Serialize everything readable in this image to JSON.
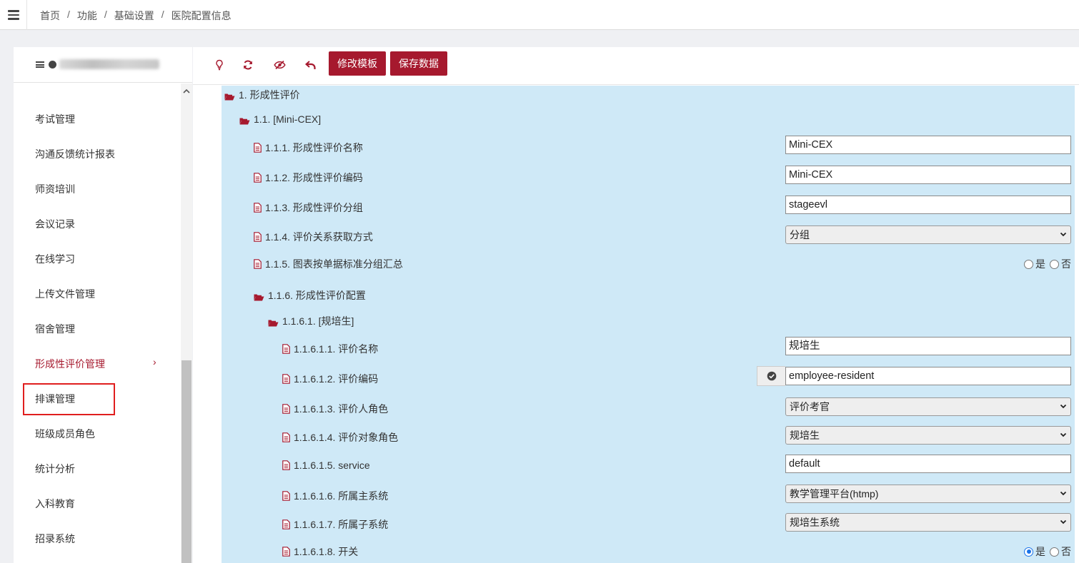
{
  "breadcrumb": [
    "首页",
    "功能",
    "基础设置",
    "医院配置信息"
  ],
  "sidebar": {
    "items": [
      {
        "label": "考试管理"
      },
      {
        "label": "沟通反馈统计报表"
      },
      {
        "label": "师资培训"
      },
      {
        "label": "会议记录"
      },
      {
        "label": "在线学习"
      },
      {
        "label": "上传文件管理"
      },
      {
        "label": "宿舍管理"
      },
      {
        "label": "形成性评价管理",
        "active": true
      },
      {
        "label": "排课管理"
      },
      {
        "label": "班级成员角色"
      },
      {
        "label": "统计分析"
      },
      {
        "label": "入科教育"
      },
      {
        "label": "招录系统"
      }
    ],
    "active_chevron": "›"
  },
  "toolbar": {
    "icons": [
      "lightbulb-icon",
      "refresh-icon",
      "eye-slash-icon",
      "undo-icon"
    ],
    "edit_template_label": "修改模板",
    "save_data_label": "保存数据"
  },
  "tree": {
    "n1": "1. 形成性评价",
    "n1_1": "1.1. [Mini-CEX]",
    "f_1_1_1": {
      "label": "1.1.1. 形成性评价名称",
      "value": "Mini-CEX"
    },
    "f_1_1_2": {
      "label": "1.1.2. 形成性评价编码",
      "value": "Mini-CEX"
    },
    "f_1_1_3": {
      "label": "1.1.3. 形成性评价分组",
      "value": "stageevl"
    },
    "f_1_1_4": {
      "label": "1.1.4. 评价关系获取方式",
      "value": "分组"
    },
    "f_1_1_5": {
      "label": "1.1.5. 图表按单据标准分组汇总",
      "yes": "是",
      "no": "否",
      "selected": "none"
    },
    "n1_1_6": "1.1.6. 形成性评价配置",
    "n1_1_6_1": "1.1.6.1. [规培生]",
    "f_1_1_6_1_1": {
      "label": "1.1.6.1.1. 评价名称",
      "value": "规培生"
    },
    "f_1_1_6_1_2": {
      "label": "1.1.6.1.2. 评价编码",
      "value": "employee-resident"
    },
    "f_1_1_6_1_3": {
      "label": "1.1.6.1.3. 评价人角色",
      "value": "评价考官"
    },
    "f_1_1_6_1_4": {
      "label": "1.1.6.1.4. 评价对象角色",
      "value": "规培生"
    },
    "f_1_1_6_1_5": {
      "label": "1.1.6.1.5. service",
      "value": "default"
    },
    "f_1_1_6_1_6": {
      "label": "1.1.6.1.6. 所属主系统",
      "value": "教学管理平台(htmp)"
    },
    "f_1_1_6_1_7": {
      "label": "1.1.6.1.7. 所属子系统",
      "value": "规培生系统"
    },
    "f_1_1_6_1_8": {
      "label": "1.1.6.1.8. 开关",
      "yes": "是",
      "no": "否",
      "selected": "yes"
    }
  },
  "colors": {
    "brand": "#a6192e",
    "tree_bg": "#cfe9f7",
    "highlight": "#e01e1e"
  }
}
